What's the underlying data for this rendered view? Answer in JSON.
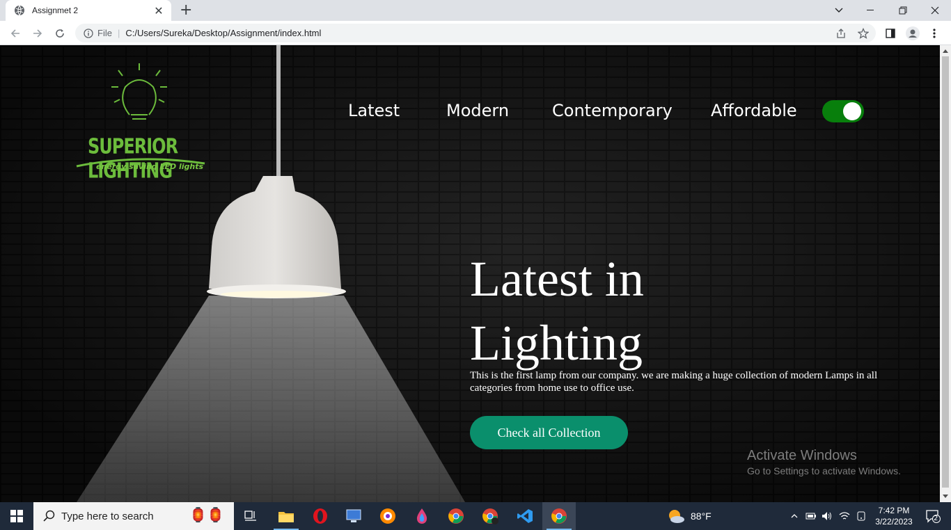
{
  "browser": {
    "tab_title": "Assignmet 2",
    "new_tab": "+",
    "omnibox": {
      "scheme_label": "File",
      "separator": "|",
      "url": "C:/Users/Sureka/Desktop/Assignment/index.html"
    }
  },
  "site": {
    "logo": {
      "brand": "SUPERIOR LIGHTING",
      "tagline": "energy saving LED lights"
    },
    "nav": [
      {
        "label": "Latest"
      },
      {
        "label": "Modern"
      },
      {
        "label": "Contemporary"
      },
      {
        "label": "Affordable"
      }
    ],
    "theme_toggle": {
      "state": "on",
      "color": "#087f0c"
    },
    "hero": {
      "title_line1": "Latest in",
      "title_line2": "Lighting",
      "description": "This is the first lamp from our company. we are making a huge collection of modern Lamps in all categories from home use to office use.",
      "cta_label": "Check all Collection",
      "cta_color": "#0a8f6c"
    }
  },
  "os": {
    "watermark": {
      "line1": "Activate Windows",
      "line2": "Go to Settings to activate Windows."
    },
    "taskbar": {
      "search_placeholder": "Type here to search",
      "apps": [
        "task-view",
        "file-explorer",
        "opera",
        "network-monitor",
        "brave",
        "color-app",
        "chrome",
        "chrome-profile",
        "vscode",
        "chrome-active"
      ],
      "weather": "88°F",
      "time": "7:42 PM",
      "date": "3/22/2023",
      "notifications": "2"
    }
  }
}
